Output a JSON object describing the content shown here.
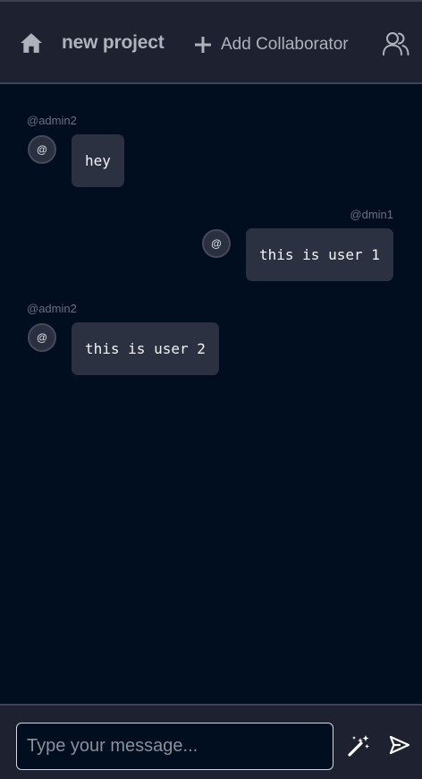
{
  "header": {
    "home_icon": "home-icon",
    "project_name": "new project",
    "add_collaborator_label": "Add Collaborator",
    "add_icon": "plus-icon",
    "users_icon": "users-icon"
  },
  "messages": [
    {
      "username": "@admin2",
      "avatar_text": "@",
      "text": "hey",
      "side": "left"
    },
    {
      "username": "@dmin1",
      "avatar_text": "@",
      "text": "this is user 1",
      "side": "right"
    },
    {
      "username": "@admin2",
      "avatar_text": "@",
      "text": "this is user 2",
      "side": "left"
    }
  ],
  "composer": {
    "placeholder": "Type your message...",
    "value": "",
    "magic_icon": "magic-wand-icon",
    "send_icon": "send-icon"
  },
  "colors": {
    "background": "#010e1f",
    "header_bg": "#1e2230",
    "bubble_bg": "#2c3142",
    "text_muted": "#aeb2bb"
  }
}
